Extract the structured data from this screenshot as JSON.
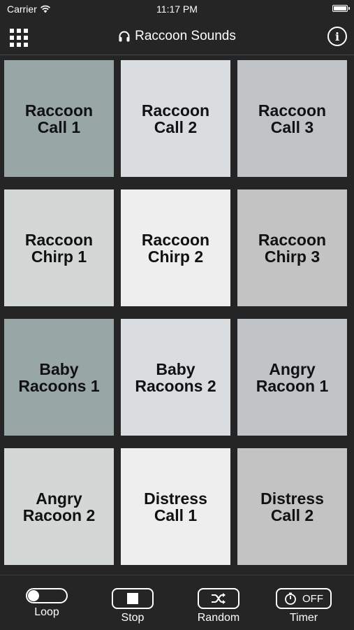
{
  "status_bar": {
    "carrier": "Carrier",
    "time": "11:17 PM"
  },
  "nav": {
    "title": "Raccoon Sounds",
    "info_label": "i",
    "title_icon": "headphones-icon",
    "menu_icon": "grid-menu-icon"
  },
  "pads": [
    {
      "label": "Raccoon\nCall 1",
      "color": "#98a6a6"
    },
    {
      "label": "Raccoon\nCall 2",
      "color": "#dadde0"
    },
    {
      "label": "Raccoon\nCall 3",
      "color": "#c1c4c7"
    },
    {
      "label": "Raccoon\nChirp 1",
      "color": "#d3d8d6"
    },
    {
      "label": "Raccoon\nChirp 2",
      "color": "#eeeeee"
    },
    {
      "label": "Raccoon\nChirp 3",
      "color": "#c3c3c3"
    },
    {
      "label": "Baby\nRacoons 1",
      "color": "#98a6a6"
    },
    {
      "label": "Baby\nRacoons 2",
      "color": "#dadde0"
    },
    {
      "label": "Angry\nRacoon 1",
      "color": "#c1c4c7"
    },
    {
      "label": "Angry\nRacoon 2",
      "color": "#d3d8d6"
    },
    {
      "label": "Distress\nCall 1",
      "color": "#eeeeee"
    },
    {
      "label": "Distress\nCall 2",
      "color": "#c3c3c3"
    }
  ],
  "toolbar": {
    "loop_label": "Loop",
    "stop_label": "Stop",
    "random_label": "Random",
    "timer_label": "Timer",
    "timer_value": "OFF"
  }
}
